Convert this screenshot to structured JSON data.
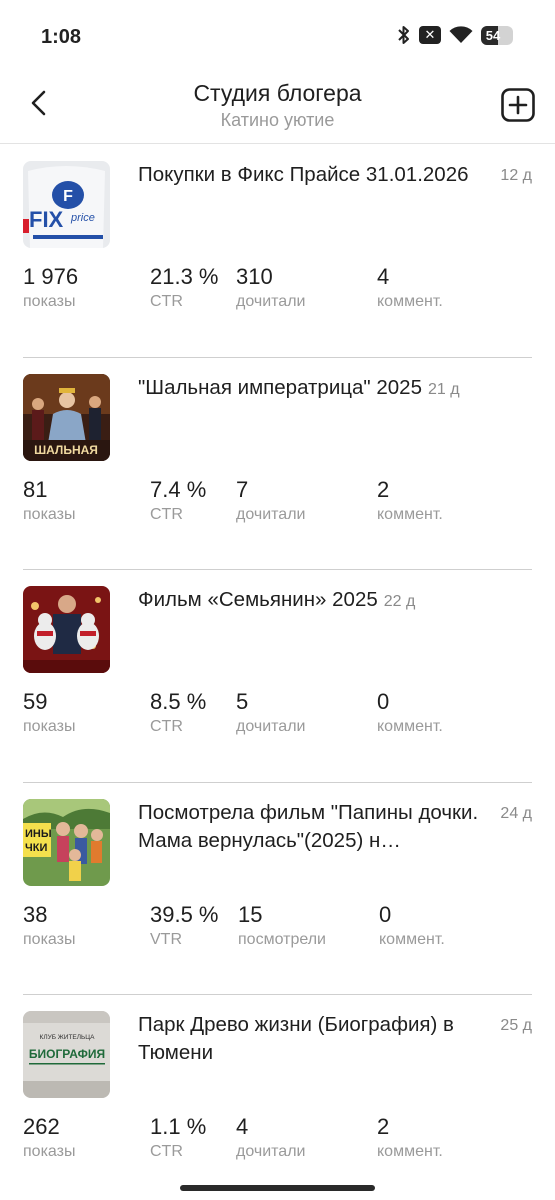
{
  "status_bar": {
    "time": "1:08",
    "battery": "54",
    "battery_level": 0.54
  },
  "header": {
    "title": "Студия блогера",
    "subtitle": "Катино уютие"
  },
  "posts": [
    {
      "title": "Покупки в Фикс Прайсе 31.01.2026",
      "age": "12 д",
      "thumb": "fix-price-bag",
      "stats": [
        {
          "value": "1 976",
          "label": "показы"
        },
        {
          "value": "21.3 %",
          "label": "CTR"
        },
        {
          "value": "310",
          "label": "дочитали"
        },
        {
          "value": "4",
          "label": "коммент."
        }
      ]
    },
    {
      "title": "\"Шальная императрица\" 2025",
      "age": "21 д",
      "thumb": "movie-poster-empress",
      "stats": [
        {
          "value": "81",
          "label": "показы"
        },
        {
          "value": "7.4 %",
          "label": "CTR"
        },
        {
          "value": "7",
          "label": "дочитали"
        },
        {
          "value": "2",
          "label": "коммент."
        }
      ]
    },
    {
      "title": "Фильм «Семьянин» 2025",
      "age": "22 д",
      "thumb": "movie-poster-family-man",
      "stats": [
        {
          "value": "59",
          "label": "показы"
        },
        {
          "value": "8.5 %",
          "label": "CTR"
        },
        {
          "value": "5",
          "label": "дочитали"
        },
        {
          "value": "0",
          "label": "коммент."
        }
      ]
    },
    {
      "title": "Посмотрела фильм \"Папины дочки. Мама вернулась\"(2025) н…",
      "age": "24 д",
      "thumb": "movie-poster-daddys-daughters",
      "stats": [
        {
          "value": "38",
          "label": "показы"
        },
        {
          "value": "39.5 %",
          "label": "VTR"
        },
        {
          "value": "15",
          "label": "посмотрели"
        },
        {
          "value": "0",
          "label": "коммент."
        }
      ]
    },
    {
      "title": "Парк Древо жизни (Биография) в Тюмени",
      "age": "25 д",
      "thumb": "biografiya-sign",
      "thumb_text_top": "КЛУБ ЖИТЕЛЬЦА",
      "thumb_text_main": "БИОГРАФИЯ",
      "stats": [
        {
          "value": "262",
          "label": "показы"
        },
        {
          "value": "1.1 %",
          "label": "CTR"
        },
        {
          "value": "4",
          "label": "дочитали"
        },
        {
          "value": "2",
          "label": "коммент."
        }
      ]
    }
  ]
}
